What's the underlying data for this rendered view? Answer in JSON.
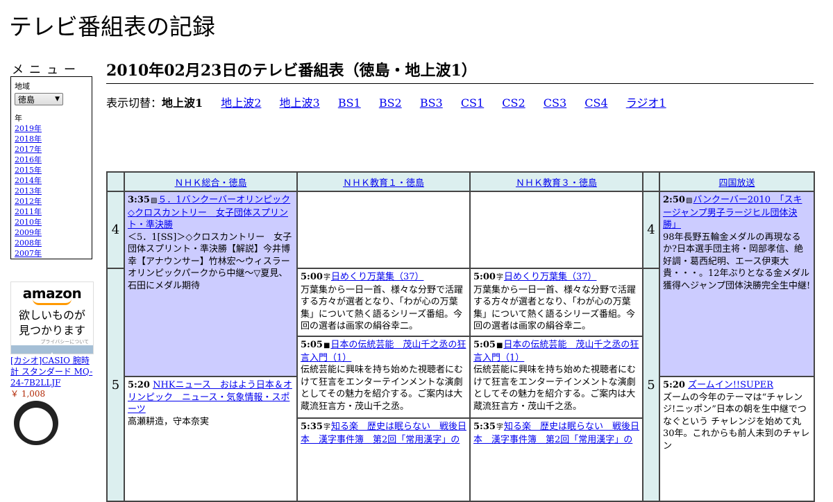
{
  "site_title": "テレビ番組表の記録",
  "menu": {
    "title": "メニュー",
    "region_label": "地域",
    "region_value": "徳島",
    "year_label": "年",
    "years": [
      "2019年",
      "2018年",
      "2017年",
      "2016年",
      "2015年",
      "2014年",
      "2013年",
      "2012年",
      "2011年",
      "2010年",
      "2009年",
      "2008年",
      "2007年"
    ]
  },
  "ad": {
    "logo": "amazon",
    "copy_line1": "欲しいものが",
    "copy_line2": "見つかります",
    "privacy": "プライバシーについて",
    "product_title": "[カシオ]CASIO 腕時計 スタンダード MQ-24-7B2LLJF",
    "product_price": "￥ 1,008"
  },
  "heading": "2010年02月23日のテレビ番組表（徳島・地上波1）",
  "switcher": {
    "label": "表示切替：",
    "current": "地上波1",
    "links": [
      "地上波2",
      "地上波3",
      "BS1",
      "BS2",
      "BS3",
      "CS1",
      "CS2",
      "CS3",
      "CS4",
      "ラジオ1"
    ]
  },
  "channels": [
    "ＮＨＫ総合・徳島",
    "ＮＨＫ教育１・徳島",
    "ＮＨＫ教育３・徳島",
    "四国放送"
  ],
  "hours": [
    "4",
    "5"
  ],
  "programs": {
    "nhk_335": {
      "time": "3:35",
      "icon": "▧",
      "title": "５．1バンクーバーオリンピック◇クロスカントリー　女子団体スプリント・準決勝",
      "desc": "＜5．1[SS]＞◇クロスカントリー　女子団体スプリント・準決勝【解説】今井博幸【アナウンサー】竹林宏～ウィスラーオリンピックパークから中継～▽夏見、石田にメダル期待"
    },
    "nhk_520": {
      "time": "5:20",
      "title": "NHKニュース　おはよう日本＆オリンピック　ニュース・気象情報・スポーツ",
      "desc": "高瀬耕造，守本奈実"
    },
    "edu1_500": {
      "time": "5:00",
      "icon": "字",
      "title": "日めくり万葉集（37）",
      "desc": "万葉集から一日一首、様々な分野で活躍する方々が選者となり、「わが心の万葉集」について熱く語るシリーズ番組。今回の選者は画家の絹谷幸二。"
    },
    "edu1_505": {
      "time": "5:05",
      "icon": "■",
      "title": "日本の伝統芸能　茂山千之丞の狂言入門（1）",
      "desc": "伝統芸能に興味を持ち始めた視聴者にむけて狂言をエンターテインメントな演劇としてその魅力を紹介する。ご案内は大蔵流狂言方・茂山千之丞。"
    },
    "edu1_535": {
      "time": "5:35",
      "icon": "字",
      "title": "知る楽　歴史は眠らない　戦後日本　漢字事件簿　第2回「常用漢字」の"
    },
    "edu3_500": {
      "time": "5:00",
      "icon": "字",
      "title": "日めくり万葉集（37）",
      "desc": "万葉集から一日一首、様々な分野で活躍する方々が選者となり、「わが心の万葉集」について熱く語るシリーズ番組。今回の選者は画家の絹谷幸二。"
    },
    "edu3_505": {
      "time": "5:05",
      "icon": "■",
      "title": "日本の伝統芸能　茂山千之丞の狂言入門（1）",
      "desc": "伝統芸能に興味を持ち始めた視聴者にむけて狂言をエンターテインメントな演劇としてその魅力を紹介する。ご案内は大蔵流狂言方・茂山千之丞。"
    },
    "edu3_535": {
      "time": "5:35",
      "icon": "字",
      "title": "知る楽　歴史は眠らない　戦後日本　漢字事件簿　第2回「常用漢字」の"
    },
    "shikoku_250": {
      "time": "2:50",
      "icon": "▧",
      "title": "バンクーバー2010　「スキージャンプ男子ラージヒル団体決勝」",
      "desc": "98年長野五輪金メダルの再現なるか?日本選手団主将・岡部孝信、絶好調・葛西紀明、エース伊東大貴・・・。12年ぶりとなる金メダル獲得へジャンプ団体決勝完全生中継!"
    },
    "shikoku_520": {
      "time": "5:20",
      "title": "ズームイン!!SUPER",
      "desc": "ズームの今年のテーマは“チャレンジ!ニッポン”日本の朝を生中継でつなぐという チャレンジを始めて丸30年。これからも前人未到のチャレン"
    }
  }
}
